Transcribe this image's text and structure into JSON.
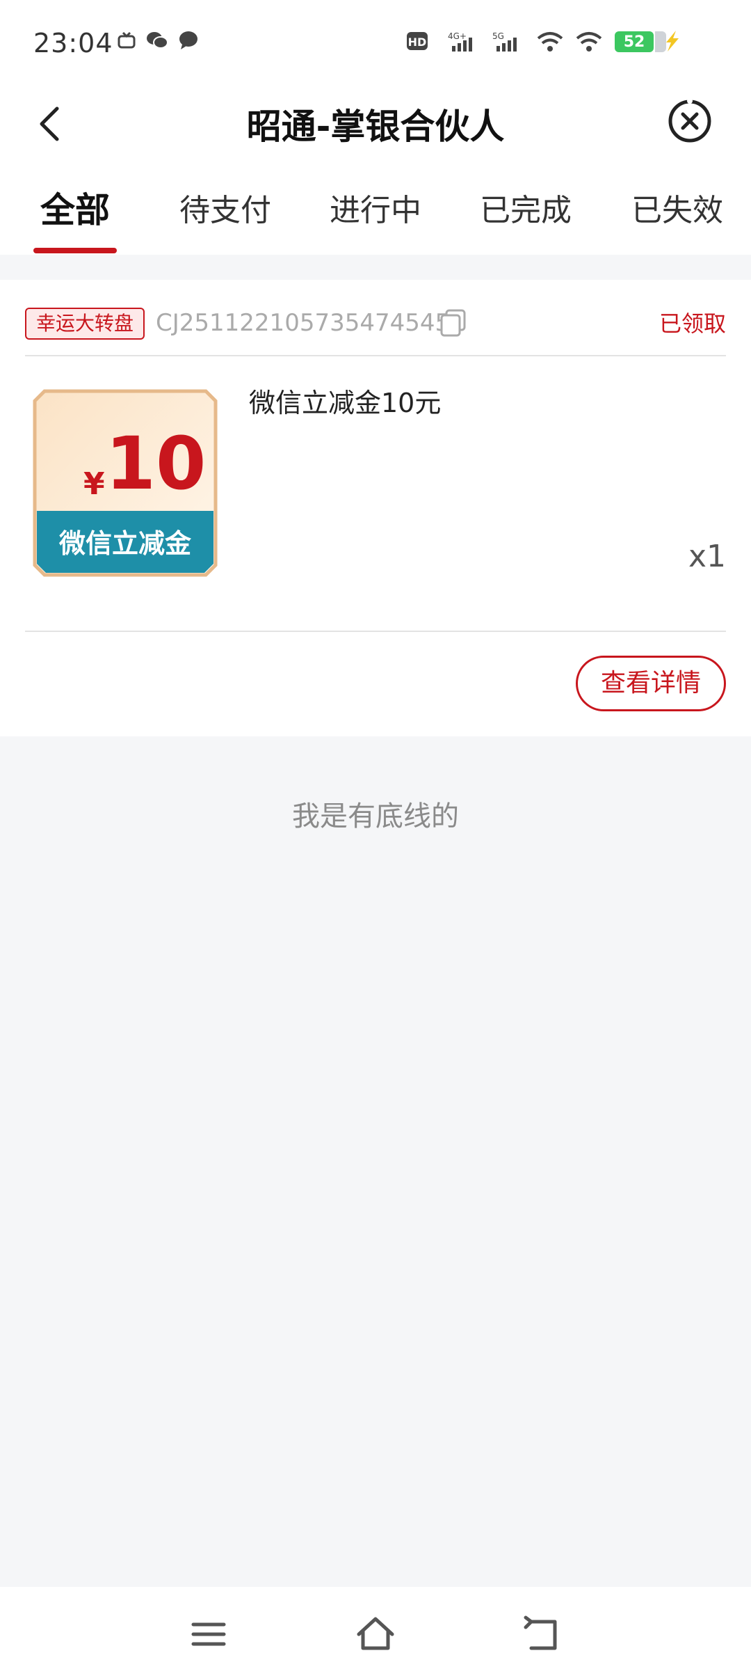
{
  "status_bar": {
    "time": "23:04",
    "battery": "52",
    "left_icons": [
      "tv-icon",
      "wechat-icon",
      "chat-bubble-icon"
    ],
    "right_icons": [
      "hd-icon",
      "signal-4g-icon",
      "signal-5g-icon",
      "wifi-icon",
      "wifi-icon-2",
      "battery-icon",
      "charging-icon"
    ]
  },
  "header": {
    "title": "昭通-掌银合伙人",
    "back_icon": "chevron-left-icon",
    "close_icon": "close-circle-icon"
  },
  "tabs": [
    {
      "label": "全部",
      "active": true
    },
    {
      "label": "待支付",
      "active": false
    },
    {
      "label": "进行中",
      "active": false
    },
    {
      "label": "已完成",
      "active": false
    },
    {
      "label": "已失效",
      "active": false
    }
  ],
  "order": {
    "tag": "幸运大转盘",
    "order_no": "CJ251122105735474545",
    "status": "已领取",
    "product_name": "微信立减金10元",
    "quantity": "x1",
    "detail_button": "查看详情",
    "coupon": {
      "currency": "¥",
      "amount": "10",
      "label": "微信立减金"
    }
  },
  "footer_text": "我是有底线的",
  "colors": {
    "accent": "#c8161d",
    "background": "#f5f6f8"
  }
}
